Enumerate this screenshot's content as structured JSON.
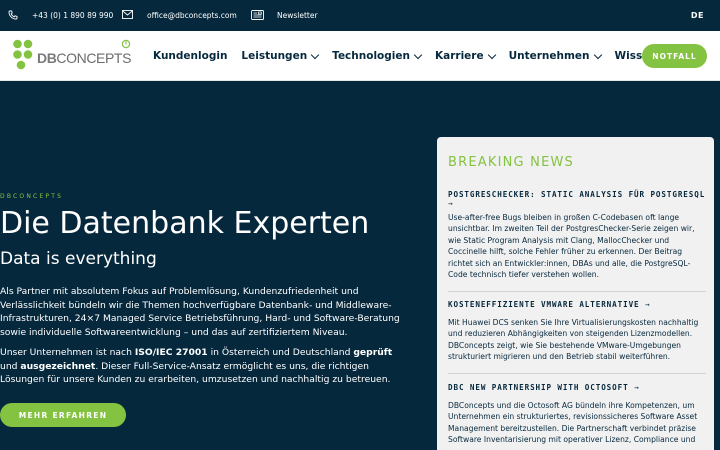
{
  "topbar": {
    "phone": "+43 (0) 1 890 89 990",
    "email": "office@dbconcepts.com",
    "newsletter": "Newsletter",
    "language": "DE"
  },
  "header": {
    "logo_text_bold": "DB",
    "logo_text_rest": "CONCEPTS",
    "nav": [
      {
        "label": "Kundenlogin"
      },
      {
        "label": "Leistungen"
      },
      {
        "label": "Technologien"
      },
      {
        "label": "Karriere"
      },
      {
        "label": "Unternehmen"
      },
      {
        "label": "Wissen"
      }
    ],
    "notfall_label": "NOTFALL"
  },
  "hero": {
    "eyebrow": "DBCONCEPTS",
    "title": "Die Datenbank Experten",
    "subtitle": "Data is everything",
    "paragraph1": "Als Partner mit absolutem Fokus auf Problemlösung, Kundenzufriedenheit und Verlässlichkeit bündeln wir die Themen hochverfügbare Datenbank- und Middleware-Infrastrukturen, 24×7 Managed Service Betriebsführung, Hard- und Software-Beratung sowie individuelle Softwareentwicklung – und das auf zertifiziertem Niveau.",
    "p2_a": "Unser Unternehmen ist nach ",
    "p2_b": "ISO/IEC 27001",
    "p2_c": " in Österreich und Deutschland ",
    "p2_d": "geprüft",
    "p2_e": " und ",
    "p2_f": "ausgezeichnet",
    "p2_g": ". Dieser Full-Service-Ansatz ermöglicht es uns, die richtigen Lösungen für unsere Kunden zu erarbeiten, umzusetzen und nachhaltig zu betreuen.",
    "cta_label": "MEHR ERFAHREN"
  },
  "news": {
    "title": "BREAKING NEWS",
    "arrow": "→",
    "articles": [
      {
        "title": "POSTGRESCHECKER: STATIC ANALYSIS FÜR POSTGRESQL",
        "body": "Use-after-free Bugs bleiben in großen C-Codebasen oft lange unsichtbar. Im zweiten Teil der PostgresChecker-Serie zeigen wir, wie Static Program Analysis mit Clang, MallocChecker und Coccinelle hilft, solche Fehler früher zu erkennen. Der Beitrag richtet sich an Entwickler:innen, DBAs und alle, die PostgreSQL-Code technisch tiefer verstehen wollen."
      },
      {
        "title": "KOSTENEFFIZIENTE VMWARE ALTERNATIVE",
        "body": "Mit Huawei DCS senken Sie Ihre Virtualisierungskosten nachhaltig und reduzieren Abhängigkeiten von steigenden Lizenzmodellen. DBConcepts zeigt, wie Sie bestehende VMware-Umgebungen strukturiert migrieren und den Betrieb stabil weiterführen."
      },
      {
        "title": "DBC NEW PARTNERSHIP WITH OCTOSOFT",
        "body": "DBConcepts und die Octosoft AG bündeln ihre Kompetenzen, um Unternehmen ein strukturiertes, revisionssicheres Software Asset Management bereitzustellen. Die Partnerschaft verbindet präzise Software Inventarisierung mit operativer Lizenz, Compliance und"
      }
    ]
  },
  "colors": {
    "navy": "#06283d",
    "accent_green": "#84c341",
    "panel": "#f1f1f1"
  }
}
